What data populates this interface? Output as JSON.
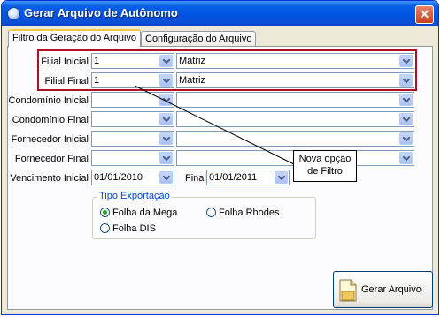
{
  "window": {
    "title": "Gerar Arquivo de Autônomo",
    "close_label": "✕"
  },
  "tabs": [
    {
      "label": "Filtro da Geração do Arquivo"
    },
    {
      "label": "Configuração do Arquivo"
    }
  ],
  "filters": {
    "filial_inicial": {
      "label": "Filial Inicial",
      "code": "1",
      "name": "Matriz"
    },
    "filial_final": {
      "label": "Filial Final",
      "code": "1",
      "name": "Matriz"
    },
    "condominio_inicial": {
      "label": "Condomínio Inicial",
      "code": "",
      "name": ""
    },
    "condominio_final": {
      "label": "Condomínio Final",
      "code": "",
      "name": ""
    },
    "fornecedor_inicial": {
      "label": "Fornecedor Inicial",
      "code": "",
      "name": ""
    },
    "fornecedor_final": {
      "label": "Fornecedor Final",
      "code": "",
      "name": ""
    },
    "vencimento": {
      "label_inicial": "Vencimento Inicial",
      "inicial": "01/01/2010",
      "label_final": "Final",
      "final": "01/01/2011"
    }
  },
  "callout": {
    "line1": "Nova opção",
    "line2": "de Filtro"
  },
  "tipo_exportacao": {
    "title": "Tipo Exportação",
    "options": [
      {
        "label": "Folha da Mega",
        "selected": true
      },
      {
        "label": "Folha Rhodes",
        "selected": false
      },
      {
        "label": "Folha DIS",
        "selected": false
      }
    ]
  },
  "gerar_button": {
    "label": "Gerar Arquivo"
  },
  "colors": {
    "titlebar": "#0054e3",
    "highlight_box": "#b01020",
    "dialog_bg": "#ece9d8",
    "group_title": "#0046d5"
  }
}
